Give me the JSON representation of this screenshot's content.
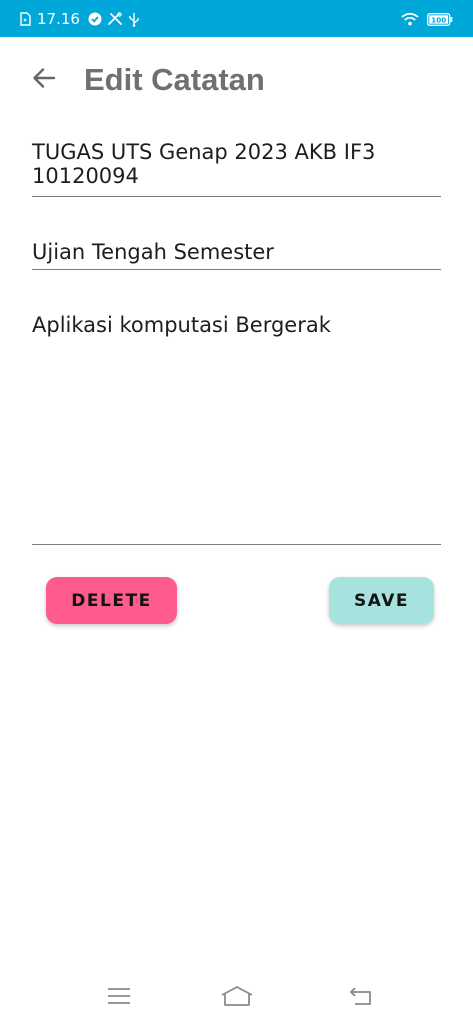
{
  "status_bar": {
    "time": "17.16",
    "battery_level": "100",
    "icons": [
      "sim-file-icon",
      "checklist-icon",
      "tools-icon",
      "usb-icon",
      "wifi-icon",
      "battery-icon"
    ]
  },
  "app_bar": {
    "title": "Edit Catatan",
    "back_icon": "arrow-left-icon"
  },
  "form": {
    "title_value": "TUGAS UTS Genap 2023 AKB IF3\n10120094",
    "subtitle_value": "Ujian Tengah Semester",
    "body_value": "Aplikasi komputasi Bergerak"
  },
  "actions": {
    "delete_label": "DELETE",
    "save_label": "SAVE"
  },
  "colors": {
    "status_bar": "#00a7d9",
    "delete_button": "#ff5b8c",
    "save_button": "#a6e3de",
    "title_text": "#707070"
  },
  "nav_bar": {
    "icons": [
      "menu-icon",
      "home-icon",
      "back-icon"
    ]
  }
}
